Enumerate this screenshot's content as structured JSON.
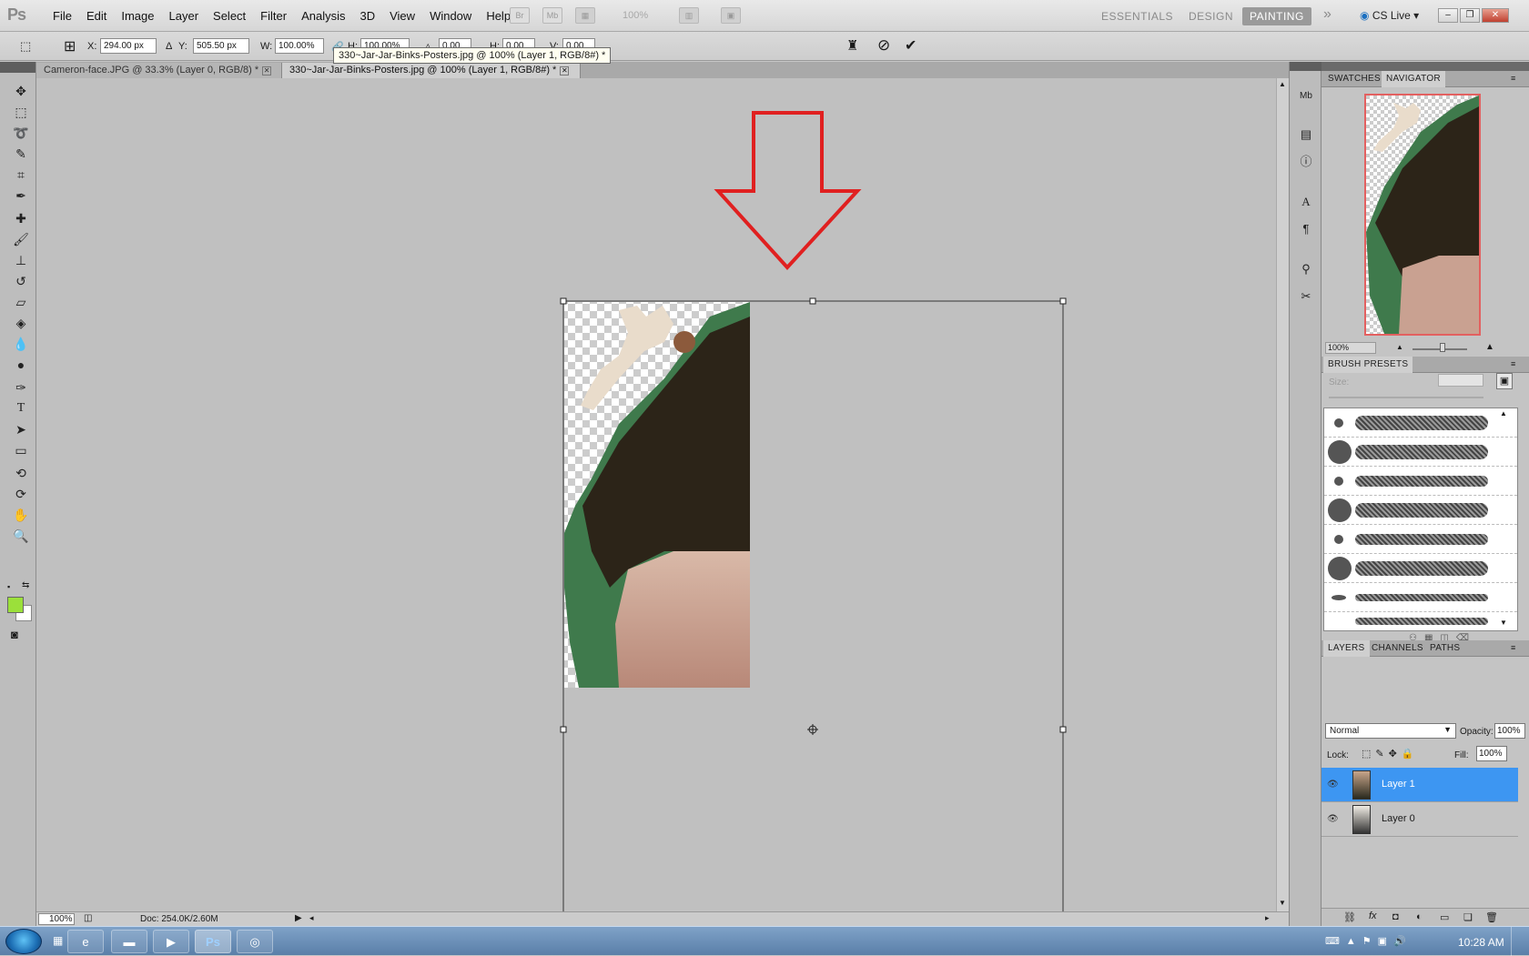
{
  "app": {
    "logo_text": "Ps",
    "menus": [
      "File",
      "Edit",
      "Image",
      "Layer",
      "Select",
      "Filter",
      "Analysis",
      "3D",
      "View",
      "Window",
      "Help"
    ],
    "zoom_menu": "100%",
    "workspaces": [
      "ESSENTIALS",
      "DESIGN",
      "PAINTING"
    ],
    "active_workspace": "PAINTING",
    "more_workspaces": "»",
    "cs_live": "CS Live"
  },
  "options": {
    "x_label": "X:",
    "x_value": "294.00 px",
    "y_label": "Y:",
    "y_value": "505.50 px",
    "w_label": "W:",
    "w_value": "100.00%",
    "h_label": "H:",
    "h_value": "100.00%",
    "angle_value": "0.00",
    "h_skew_label": "H:",
    "h_skew_value": "0.00",
    "v_skew_label": "V:",
    "v_skew_value": "0.00"
  },
  "tooltip": "330~Jar-Jar-Binks-Posters.jpg @ 100% (Layer 1, RGB/8#) *",
  "tabs": [
    {
      "label": "Cameron-face.JPG @ 33.3% (Layer 0, RGB/8) *"
    },
    {
      "label": "330~Jar-Jar-Binks-Posters.jpg @ 100% (Layer 1, RGB/8#) *"
    }
  ],
  "status": {
    "zoom": "100%",
    "doc": "Doc: 254.0K/2.60M"
  },
  "panels": {
    "navigator_tabs": [
      "SWATCHES",
      "NAVIGATOR"
    ],
    "navigator_zoom": "100%",
    "brush_title": "BRUSH PRESETS",
    "brush_size_label": "Size:",
    "layers_tabs": [
      "LAYERS",
      "CHANNELS",
      "PATHS"
    ],
    "blend_mode": "Normal",
    "opacity_label": "Opacity:",
    "opacity_value": "100%",
    "lock_label": "Lock:",
    "fill_label": "Fill:",
    "fill_value": "100%",
    "layers": [
      {
        "name": "Layer 1",
        "selected": true
      },
      {
        "name": "Layer 0",
        "selected": false
      }
    ]
  },
  "colors": {
    "foreground": "#9be03a",
    "background": "#ffffff",
    "arrow": "#e02020",
    "selected_layer": "#3d96f2"
  },
  "taskbar": {
    "clock": "10:28 AM"
  }
}
